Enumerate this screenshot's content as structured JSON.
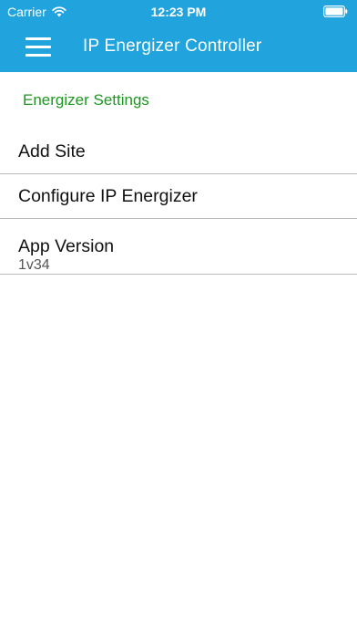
{
  "status_bar": {
    "carrier": "Carrier",
    "time": "12:23 PM",
    "icons": [
      "wifi-icon",
      "battery-icon"
    ]
  },
  "app_bar": {
    "title": "IP Energizer Controller",
    "menu_icon": "hamburger-menu-icon",
    "background_color": "#21a3de"
  },
  "settings": {
    "section_title": "Energizer Settings",
    "section_title_color": "#1e9622",
    "items": [
      {
        "label": "Add Site"
      },
      {
        "label": "Configure IP Energizer"
      },
      {
        "label": "App Version",
        "value": "1v34"
      }
    ]
  }
}
